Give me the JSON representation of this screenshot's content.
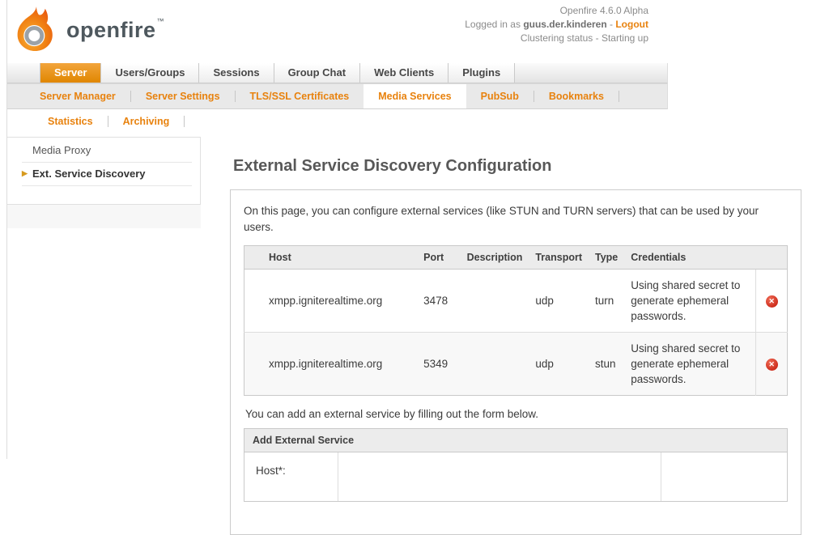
{
  "header": {
    "logo_text": "openfire",
    "trademark": "™",
    "version": "Openfire 4.6.0 Alpha",
    "logged_in_prefix": "Logged in as ",
    "username": "guus.der.kinderen",
    "login_separator": " - ",
    "logout_label": "Logout",
    "clustering_status": "Clustering status - Starting up"
  },
  "nav": {
    "tabs": [
      {
        "label": "Server",
        "active": true
      },
      {
        "label": "Users/Groups",
        "active": false
      },
      {
        "label": "Sessions",
        "active": false
      },
      {
        "label": "Group Chat",
        "active": false
      },
      {
        "label": "Web Clients",
        "active": false
      },
      {
        "label": "Plugins",
        "active": false
      }
    ]
  },
  "subnav": {
    "items": [
      {
        "label": "Server Manager",
        "active": false
      },
      {
        "label": "Server Settings",
        "active": false
      },
      {
        "label": "TLS/SSL Certificates",
        "active": false
      },
      {
        "label": "Media Services",
        "active": true
      },
      {
        "label": "PubSub",
        "active": false
      },
      {
        "label": "Bookmarks",
        "active": false
      }
    ]
  },
  "thirdnav": {
    "items": [
      {
        "label": "Statistics"
      },
      {
        "label": "Archiving"
      }
    ]
  },
  "sidebar": {
    "items": [
      {
        "label": "Media Proxy",
        "active": false
      },
      {
        "label": "Ext. Service Discovery",
        "active": true
      }
    ]
  },
  "main": {
    "title": "External Service Discovery Configuration",
    "intro": "On this page, you can configure external services (like STUN and TURN servers) that can be used by your users.",
    "table": {
      "columns": [
        "Host",
        "Port",
        "Description",
        "Transport",
        "Type",
        "Credentials"
      ],
      "rows": [
        {
          "host": "xmpp.igniterealtime.org",
          "port": "3478",
          "description": "",
          "transport": "udp",
          "type": "turn",
          "credentials": "Using shared secret to generate ephemeral passwords."
        },
        {
          "host": "xmpp.igniterealtime.org",
          "port": "5349",
          "description": "",
          "transport": "udp",
          "type": "stun",
          "credentials": "Using shared secret to generate ephemeral passwords."
        }
      ]
    },
    "add_hint": "You can add an external service by filling out the form below.",
    "form": {
      "title": "Add External Service",
      "host_label": "Host*:"
    }
  },
  "icons": {
    "delete_glyph": "✕",
    "arrow_glyph": "▶"
  },
  "colors": {
    "accent_orange": "#e8820e",
    "tab_active_orange": "#e8920e",
    "delete_red": "#d23a2a",
    "logo_grey": "#4e585e"
  }
}
